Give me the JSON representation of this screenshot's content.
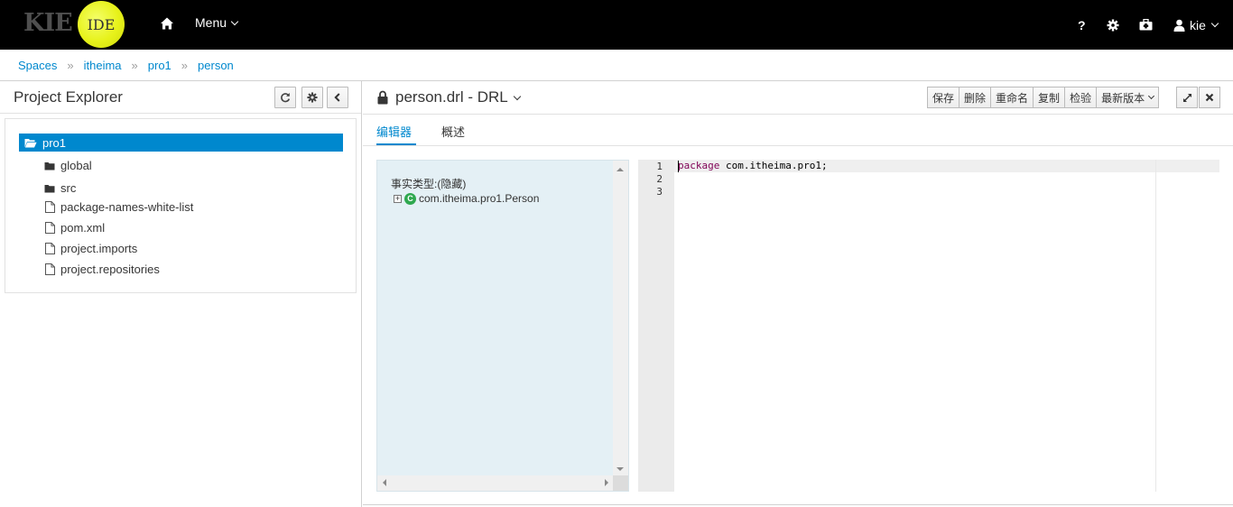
{
  "topbar": {
    "logo_kie": "KIE",
    "logo_ide": "IDE",
    "menu_label": "Menu",
    "help_label": "?",
    "user_label": "kie"
  },
  "breadcrumb": [
    "Spaces",
    "itheima",
    "pro1",
    "person"
  ],
  "breadcrumb_separator": "»",
  "project_explorer": {
    "title": "Project Explorer",
    "root": "pro1",
    "folders": [
      "global",
      "src"
    ],
    "files": [
      "package-names-white-list",
      "pom.xml",
      "project.imports",
      "project.repositories"
    ]
  },
  "editor": {
    "file_title": "person.drl - DRL",
    "buttons": {
      "save": "保存",
      "delete": "删除",
      "rename": "重命名",
      "copy": "复制",
      "validate": "检验",
      "latest_version": "最新版本"
    },
    "tabs": {
      "editor": "编辑器",
      "overview": "概述"
    },
    "facts_title": "事实类型:(隐藏)",
    "fact_class": "com.itheima.pro1.Person",
    "class_icon_letter": "C",
    "line_numbers": [
      "1",
      "2",
      "3"
    ],
    "code": {
      "keyword": "package",
      "rest": " com.itheima.pro1;"
    }
  },
  "colors": {
    "accent": "#0088ce",
    "topbar": "#000000",
    "logo_ball": "#e7f21a",
    "facts_bg": "#e4f0f5",
    "class_icon": "#2fa84f",
    "keyword": "#7f0055"
  }
}
